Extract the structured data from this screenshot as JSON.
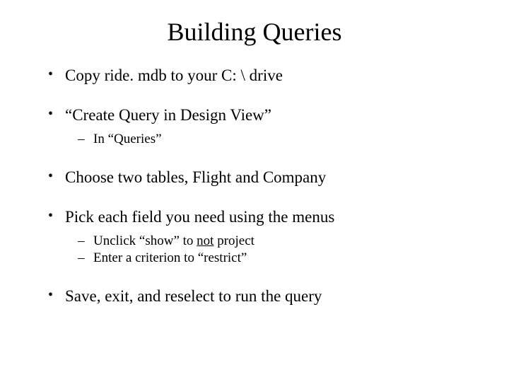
{
  "title": "Building Queries",
  "bullets": {
    "b0": "Copy ride. mdb to your C: \\ drive",
    "b1": "“Create Query in Design View”",
    "b1_sub0": "In “Queries”",
    "b2": "Choose two tables, Flight and Company",
    "b3": "Pick each field you need using the menus",
    "b3_sub0_pre": "Unclick “show” to ",
    "b3_sub0_underlined": "not",
    "b3_sub0_post": " project",
    "b3_sub1": "Enter a criterion to “restrict”",
    "b4": "Save, exit, and reselect to run the query"
  }
}
